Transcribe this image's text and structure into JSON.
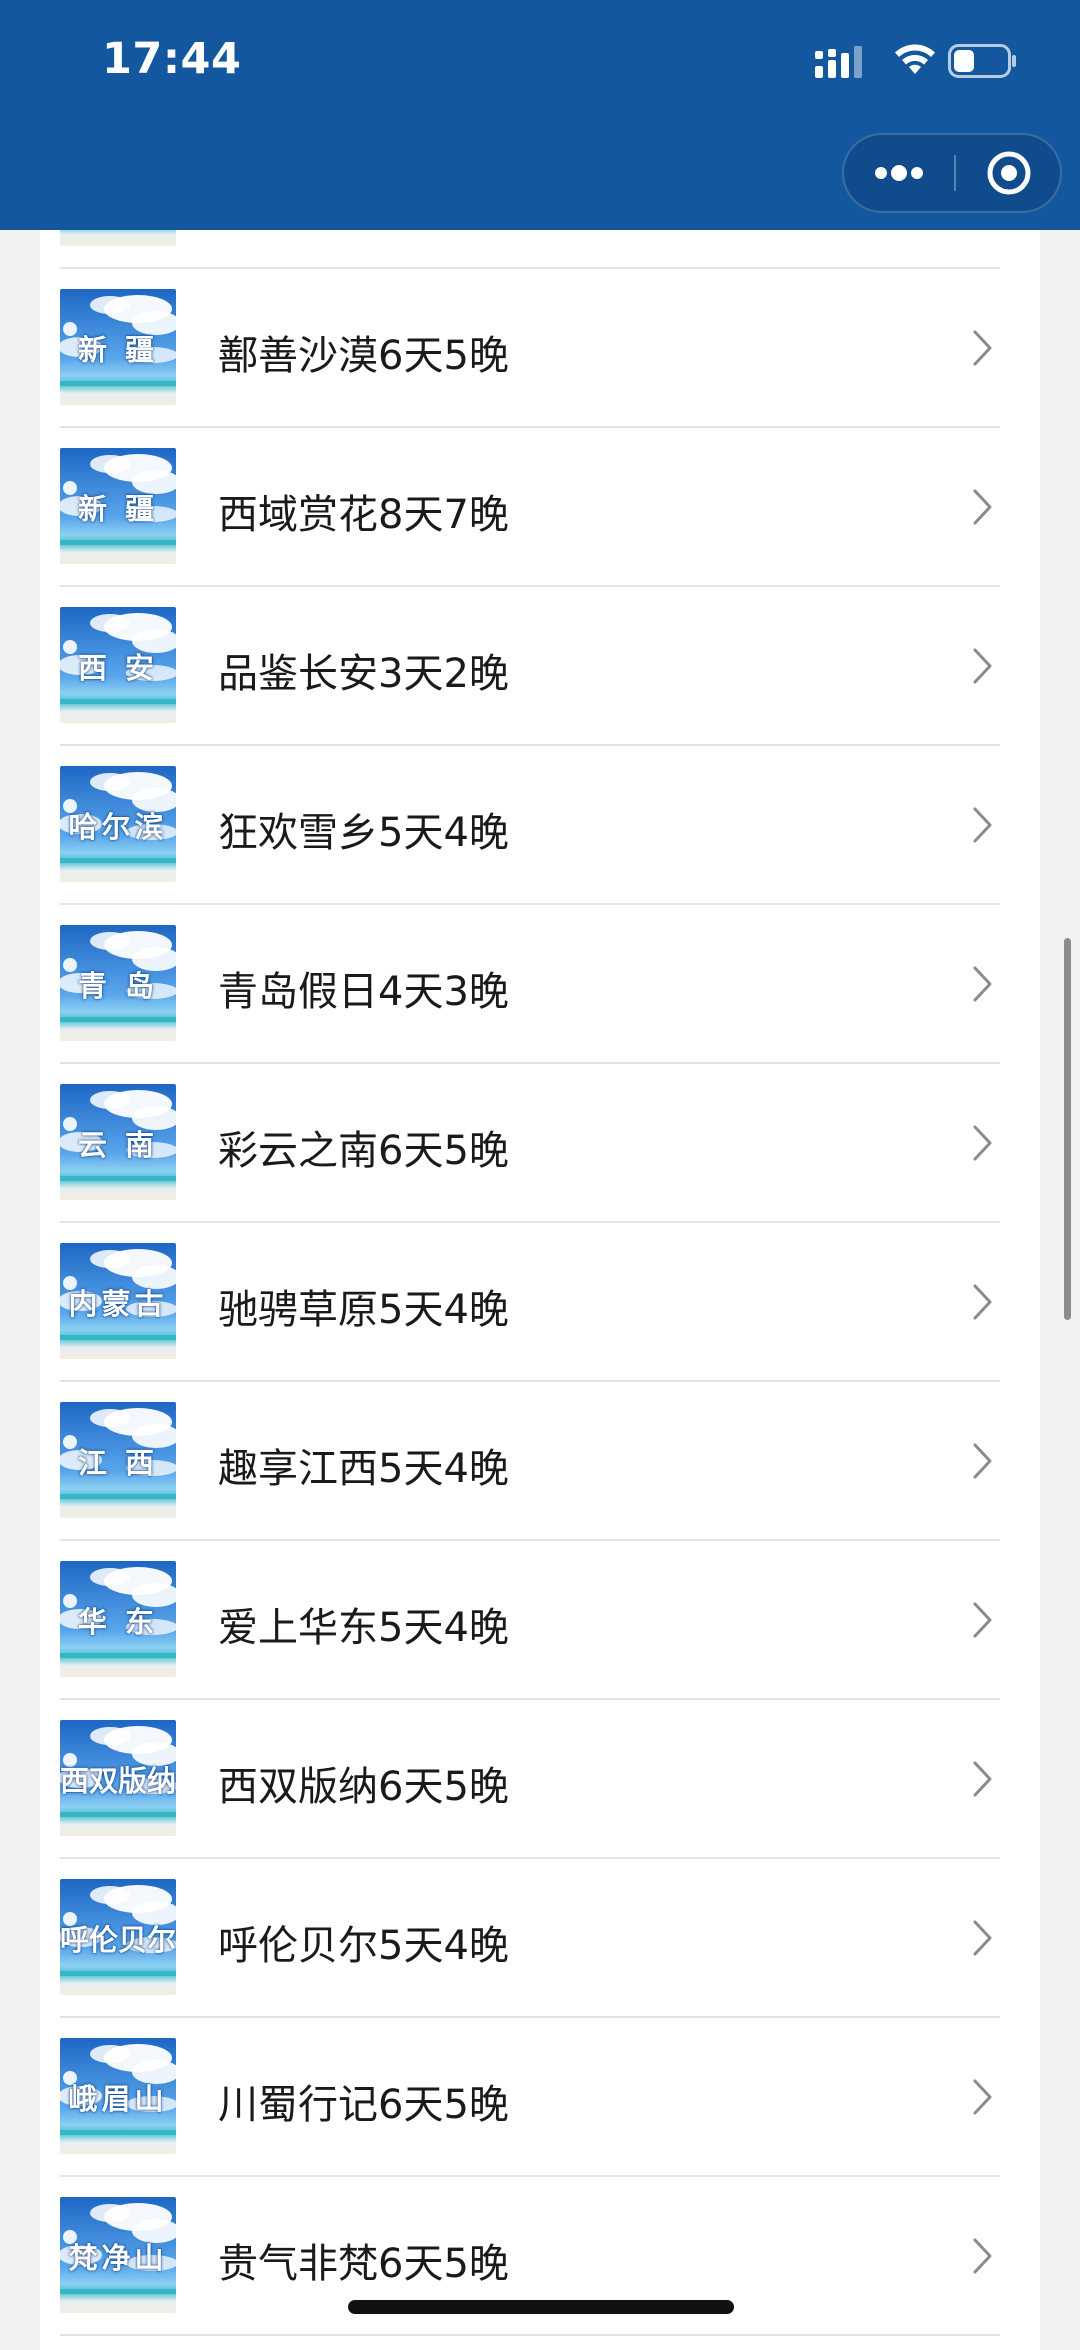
{
  "status_bar": {
    "time": "17:44",
    "icons": [
      "cellular-signal-icon",
      "wifi-icon",
      "battery-icon"
    ]
  },
  "capsule": {
    "icons": [
      "more-dots-icon",
      "close-target-icon"
    ]
  },
  "colors": {
    "header_bg": "#13579f",
    "page_bg": "#f2f2f2",
    "card_bg": "#ffffff",
    "title_text": "#1a1a1a",
    "divider": "#e3e3e3",
    "chevron": "#8a8a8a"
  },
  "routes": [
    {
      "region": "新 疆",
      "title": "鄯善沙漠6天5晚"
    },
    {
      "region": "新 疆",
      "title": "西域赏花8天7晚"
    },
    {
      "region": "西 安",
      "title": "品鉴长安3天2晚"
    },
    {
      "region": "哈尔滨",
      "title": "狂欢雪乡5天4晚"
    },
    {
      "region": "青 岛",
      "title": "青岛假日4天3晚"
    },
    {
      "region": "云 南",
      "title": "彩云之南6天5晚"
    },
    {
      "region": "内蒙古",
      "title": "驰骋草原5天4晚"
    },
    {
      "region": "江 西",
      "title": "趣享江西5天4晚"
    },
    {
      "region": "华 东",
      "title": "爱上华东5天4晚"
    },
    {
      "region": "西双版纳",
      "title": "西双版纳6天5晚"
    },
    {
      "region": "呼伦贝尔",
      "title": "呼伦贝尔5天4晚"
    },
    {
      "region": "峨眉山",
      "title": "川蜀行记6天5晚"
    },
    {
      "region": "梵净山",
      "title": "贵气非梵6天5晚"
    }
  ]
}
